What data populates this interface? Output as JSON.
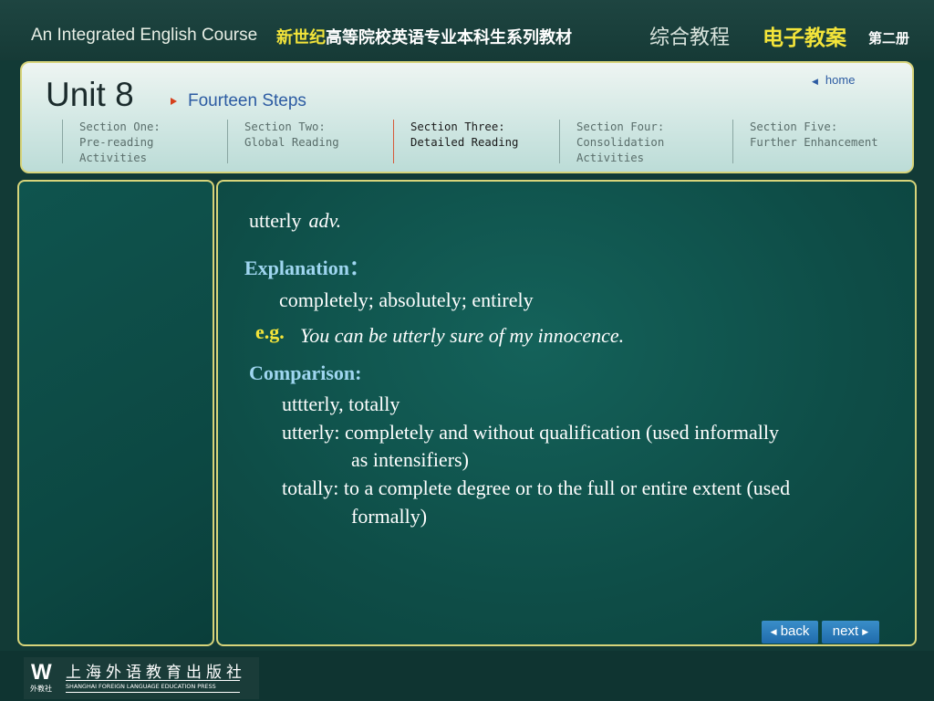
{
  "header": {
    "course_en": "An Integrated English Course",
    "course_cn_highlight": "新世纪",
    "course_cn_rest": "高等院校英语专业本科生系列教材",
    "course_title": "综合教程",
    "edition": "电子教案",
    "volume": "第二册"
  },
  "unit": {
    "title": "Unit 8",
    "lesson": "Fourteen Steps",
    "home_label": "home",
    "home_icon": "left-triangle-icon"
  },
  "sections": [
    {
      "line1": "Section One:",
      "line2": "Pre-reading Activities",
      "active": false
    },
    {
      "line1": "Section Two:",
      "line2": "Global Reading",
      "active": false
    },
    {
      "line1": "Section Three:",
      "line2": "Detailed Reading",
      "active": true
    },
    {
      "line1": "Section Four:",
      "line2": "Consolidation Activities",
      "active": false
    },
    {
      "line1": "Section Five:",
      "line2": "Further Enhancement",
      "active": false
    }
  ],
  "content": {
    "word": "utterly",
    "part_of_speech": "adv.",
    "explanation_heading": "Explanation：",
    "explanation": "completely; absolutely; entirely",
    "example_label": "e.g.",
    "example": "You can be utterly sure of my innocence.",
    "comparison_heading": "Comparison:",
    "comparison_lines": [
      "uttterly, totally",
      "utterly: completely and without qualification (used informally",
      "as intensifiers)",
      "totally: to a complete degree or to the full or entire extent (used",
      "formally)"
    ]
  },
  "navigation": {
    "back_label": "back",
    "next_label": "next"
  },
  "publisher": {
    "logo_text": "W",
    "logo_sub": "外教社",
    "name_cn": "上海外语教育出版社",
    "name_en": "SHANGHAI FOREIGN LANGUAGE EDUCATION PRESS"
  },
  "colors": {
    "background": "#123a36",
    "panel_border": "#d7d47a",
    "heading_blue": "#9fd6f0",
    "example_yellow": "#f3e43a",
    "nav_button": "#2a7cbc",
    "lesson_blue": "#2c5ba2"
  }
}
